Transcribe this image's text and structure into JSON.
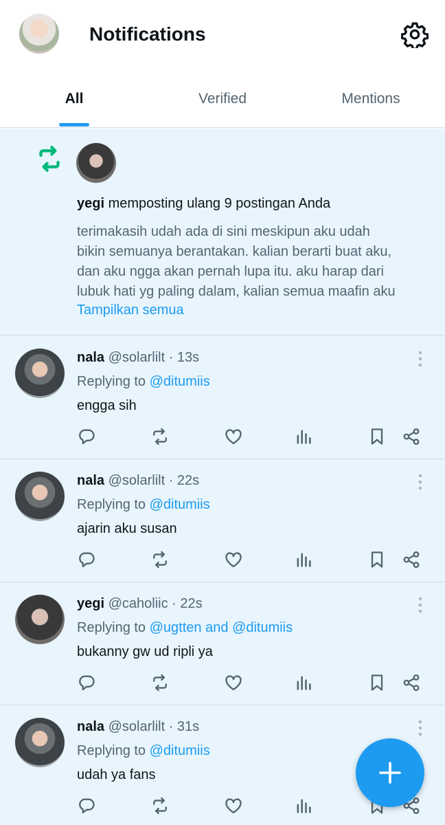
{
  "header": {
    "title": "Notifications",
    "avatar_icon": "profile-avatar",
    "settings_icon": "gear-icon"
  },
  "tabs": [
    {
      "label": "All",
      "active": true
    },
    {
      "label": "Verified",
      "active": false
    },
    {
      "label": "Mentions",
      "active": false
    }
  ],
  "repost_notice": {
    "icon": "repost-icon",
    "name": "yegi",
    "action": "memposting ulang 9 postingan Anda",
    "text_lines": [
      "terimakasih udah ada di sini meskipun aku udah",
      "bikin semuanya berantakan. kalian berarti buat aku,",
      "dan aku ngga akan pernah lupa itu. aku harap dari",
      "lubuk hati yg paling dalam, kalian semua maafin aku"
    ],
    "show_all": "Tampilkan semua"
  },
  "posts": [
    {
      "name": "nala",
      "meta": "@solarlilt · 13s",
      "reply_prefix": "Replying to",
      "reply_to": "@ditumiis",
      "text": "engga sih"
    },
    {
      "name": "nala",
      "meta": "@solarlilt · 22s",
      "reply_prefix": "Replying to",
      "reply_to": "@ditumiis",
      "text": "ajarin aku susan"
    },
    {
      "name": "yegi",
      "meta": "@caholiic · 22s",
      "reply_prefix": "Replying to",
      "reply_to": "@ugtten and @ditumiis",
      "text": "bukanny gw ud ripli ya"
    },
    {
      "name": "nala",
      "meta": "@solarlilt · 31s",
      "reply_prefix": "Replying to",
      "reply_to": "@ditumiis",
      "text": "udah ya fans"
    }
  ],
  "action_icons": [
    "reply-icon",
    "retweet-icon",
    "like-icon",
    "views-icon",
    "bookmark-icon",
    "share-icon"
  ],
  "fab": {
    "icon": "plus-icon"
  },
  "colors": {
    "accent": "#1d9bf0",
    "repost_green": "#00ba7c",
    "feed_bg": "#e8f5fd"
  }
}
